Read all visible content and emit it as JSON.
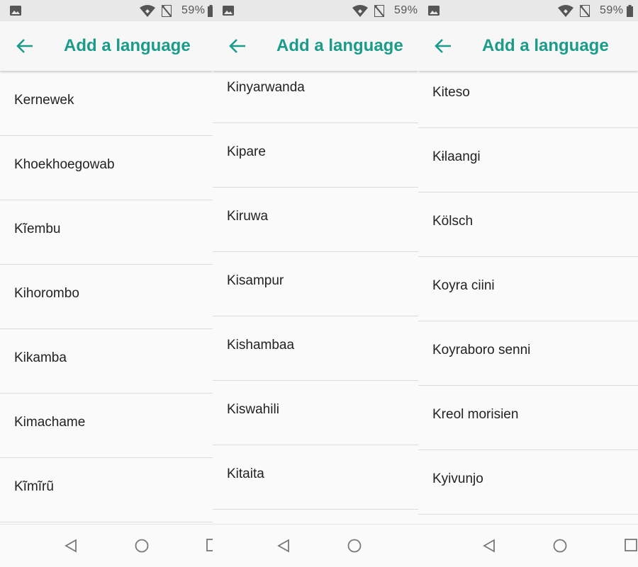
{
  "accent_color": "#1b9b8a",
  "panels": [
    {
      "status": {
        "battery_text": "59%",
        "icons": [
          "image-icon",
          "wifi-icon",
          "no-sim-icon",
          "battery-icon"
        ]
      },
      "appbar": {
        "title": "Add a language",
        "back_icon": "arrow-left-icon"
      },
      "languages": [
        "Kernewek",
        "Khoekhoegowab",
        "Kĩembu",
        "Kihorombo",
        "Kikamba",
        "Kimachame",
        "Kĩmĩrũ"
      ],
      "nav": [
        "back-triangle-icon",
        "home-circle-icon",
        "recents-square-icon"
      ]
    },
    {
      "status": {
        "battery_text": "59%",
        "icons": [
          "image-icon",
          "wifi-icon",
          "no-sim-icon",
          "battery-icon"
        ]
      },
      "appbar": {
        "title": "Add a language",
        "back_icon": "arrow-left-icon"
      },
      "languages": [
        "Kinyarwanda",
        "Kipare",
        "Kiruwa",
        "Kisampur",
        "Kishambaa",
        "Kiswahili",
        "Kitaita"
      ],
      "nav": [
        "back-triangle-icon",
        "home-circle-icon",
        "recents-square-icon"
      ]
    },
    {
      "status": {
        "battery_text": "59%",
        "icons": [
          "image-icon",
          "wifi-icon",
          "no-sim-icon",
          "battery-icon"
        ]
      },
      "appbar": {
        "title": "Add a language",
        "back_icon": "arrow-left-icon"
      },
      "languages": [
        "Kiteso",
        "Kɨlaangi",
        "Kölsch",
        "Koyra ciini",
        "Koyraboro senni",
        "Kreol morisien",
        "Kyivunjo"
      ],
      "nav": [
        "back-triangle-icon",
        "home-circle-icon",
        "recents-square-icon"
      ]
    }
  ]
}
